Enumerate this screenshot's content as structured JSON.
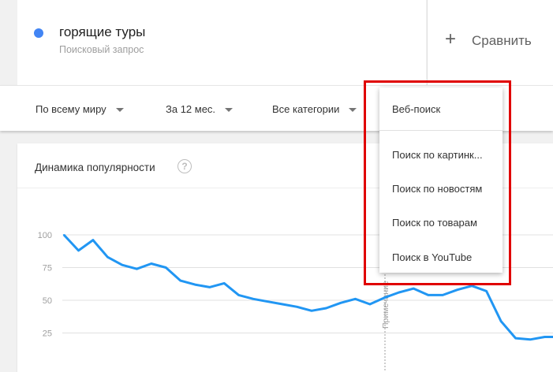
{
  "search_term": {
    "name": "горящие туры",
    "subtitle": "Поисковый запрос",
    "color": "#4285f4"
  },
  "compare": {
    "plus": "+",
    "label": "Сравнить"
  },
  "filters": {
    "region": "По всему миру",
    "period": "За 12 мес.",
    "category": "Все категории"
  },
  "dropdown": {
    "items": [
      "Веб-поиск",
      "Поиск по картинк...",
      "Поиск по новостям",
      "Поиск по товарам",
      "Поиск в YouTube"
    ],
    "highlight_color": "#e00000"
  },
  "chart": {
    "title": "Динамика популярности",
    "help": "?",
    "note_label": "Примечание"
  },
  "chart_data": {
    "type": "line",
    "title": "Динамика популярности",
    "yticks": [
      100,
      75,
      50,
      25
    ],
    "ylim": [
      0,
      100
    ],
    "grid": true,
    "series_color": "#2196f3",
    "values": [
      100,
      88,
      96,
      83,
      77,
      74,
      78,
      75,
      65,
      62,
      60,
      63,
      54,
      51,
      49,
      47,
      45,
      42,
      44,
      48,
      51,
      47,
      52,
      56,
      59,
      54,
      54,
      58,
      61,
      57,
      34,
      21,
      20,
      22,
      22
    ]
  }
}
